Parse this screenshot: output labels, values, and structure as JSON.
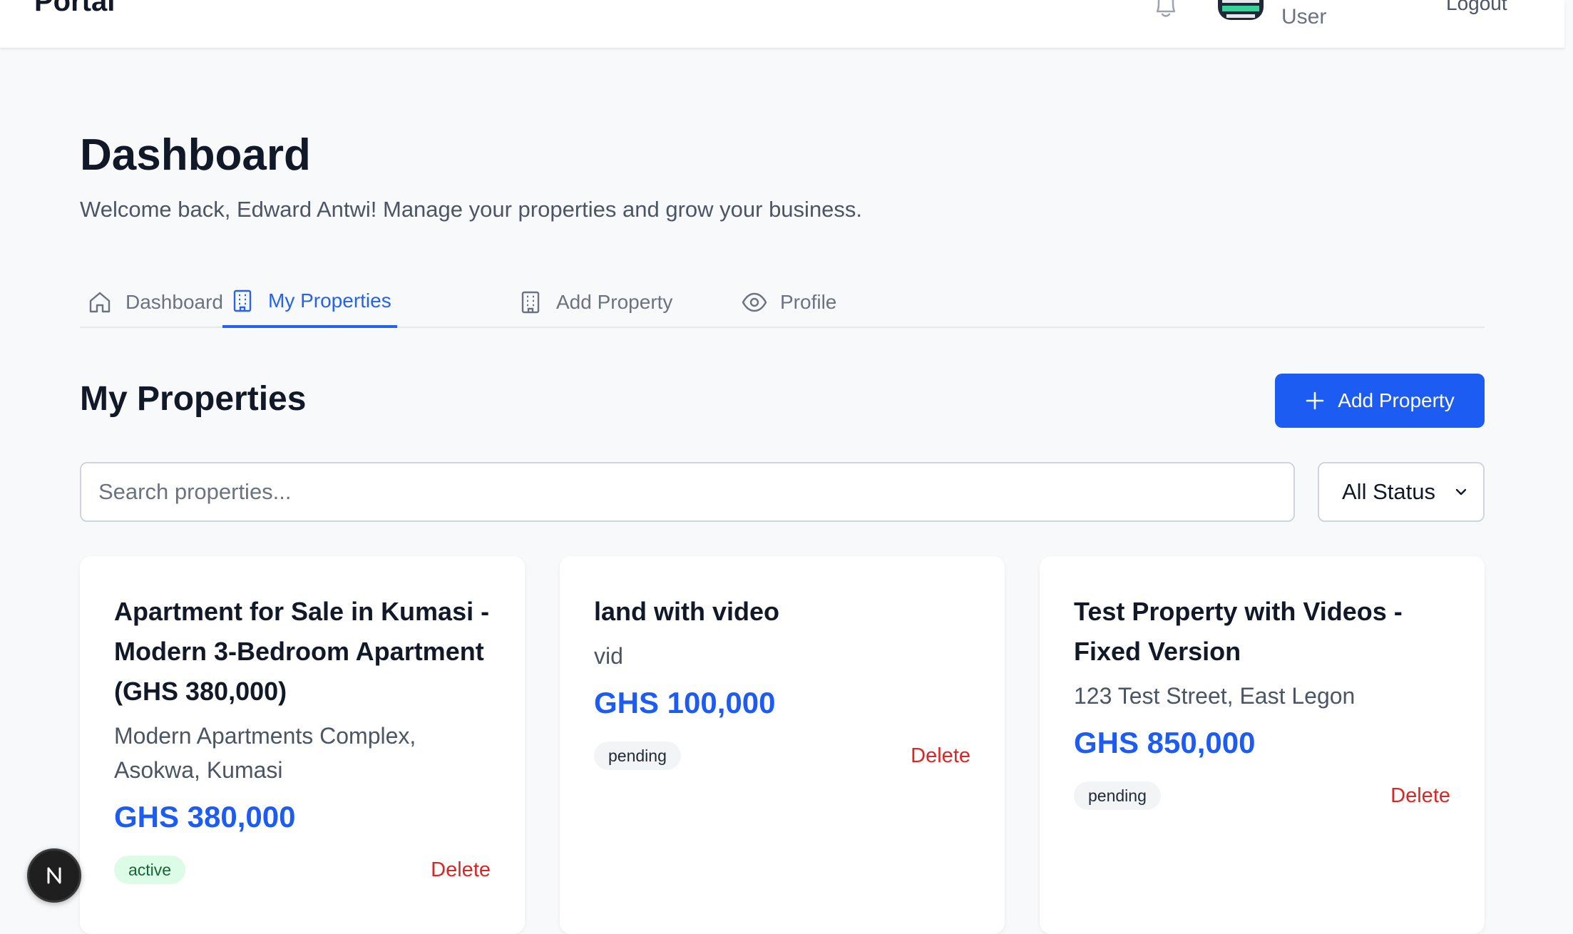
{
  "header": {
    "brand": "Portal",
    "user_role": "User",
    "logout_label": "Logout"
  },
  "page": {
    "title": "Dashboard",
    "welcome": "Welcome back, Edward Antwi! Manage your properties and grow your business."
  },
  "tabs": [
    {
      "label": "Dashboard",
      "icon": "home-icon",
      "active": false
    },
    {
      "label": "My Properties",
      "icon": "building-icon",
      "active": true
    },
    {
      "label": "Add Property",
      "icon": "building-icon",
      "active": false
    },
    {
      "label": "Profile",
      "icon": "eye-icon",
      "active": false
    }
  ],
  "section": {
    "title": "My Properties",
    "add_button": "Add Property"
  },
  "filters": {
    "search_placeholder": "Search properties...",
    "status_selected": "All Status"
  },
  "properties": [
    {
      "title": "Apartment for Sale in Kumasi - Modern 3-Bedroom Apartment (GHS 380,000)",
      "location": "Modern Apartments Complex, Asokwa, Kumasi",
      "price": "GHS 380,000",
      "status": "active",
      "delete_label": "Delete"
    },
    {
      "title": "land with video",
      "location": "vid",
      "price": "GHS 100,000",
      "status": "pending",
      "delete_label": "Delete"
    },
    {
      "title": "Test Property with Videos - Fixed Version",
      "location": "123 Test Street, East Legon",
      "price": "GHS 850,000",
      "status": "pending",
      "delete_label": "Delete"
    }
  ],
  "dev_badge": {
    "label": "N"
  },
  "colors": {
    "accent": "#1d5cf2",
    "danger": "#dc2626",
    "active_badge_bg": "#dcfce7",
    "pending_badge_bg": "#f3f4f6"
  }
}
